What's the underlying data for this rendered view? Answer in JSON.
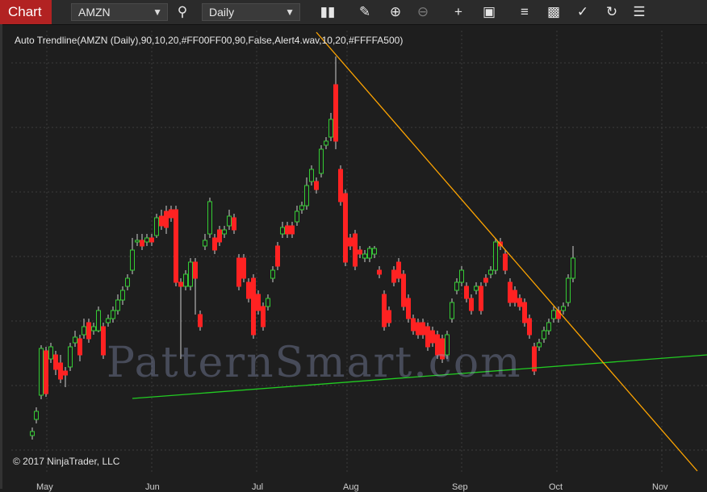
{
  "toolbar": {
    "chart_tab": "Chart",
    "instrument": "AMZN",
    "period": "Daily",
    "icons": [
      "bars-type-icon",
      "pencil-icon",
      "zoom-in-icon",
      "zoom-out-icon",
      "crosshair-icon",
      "data-box-icon",
      "properties-icon",
      "templates-icon",
      "strategies-icon",
      "reload-icon",
      "menu-icon"
    ]
  },
  "indicator_label": "Auto Trendline(AMZN (Daily),90,10,20,#FF00FF00,90,False,Alert4.wav,10,20,#FFFFA500)",
  "watermark": "PatternSmart.com",
  "copyright": "© 2017 NinjaTrader, LLC",
  "colors": {
    "up": "#33cc33",
    "down": "#ff2222",
    "support_line": "#22cc22",
    "resistance_line": "#ffa500",
    "grid": "#3c3c3c"
  },
  "chart_data": {
    "type": "candlestick",
    "x_labels": [
      "May",
      "Jun",
      "Jul",
      "Aug",
      "Sep",
      "Oct",
      "Nov"
    ],
    "trendlines": [
      {
        "name": "support",
        "color": "#22cc22"
      },
      {
        "name": "resistance",
        "color": "#FFA500"
      }
    ]
  }
}
